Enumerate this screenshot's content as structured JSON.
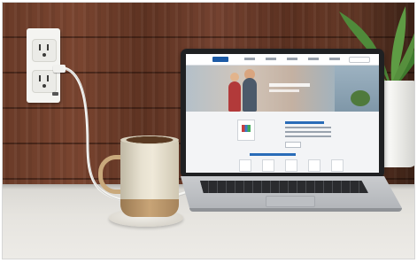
{
  "scene": {
    "subject": "",
    "objects": [
      "wall-outlet-with-usb",
      "charging-cable",
      "coffee-mug",
      "stone-coaster",
      "laptop",
      "potted-plant"
    ]
  },
  "colors": {
    "wood_wall": "#6a3b28",
    "counter": "#e6e4df",
    "outlet_plate": "#f4f4f1",
    "mug_body": "#e7e1d0",
    "mug_base": "#c8a477",
    "laptop_lid": "#1f2022",
    "site_accent": "#2a6cb8",
    "plant_leaf": "#4f8a3a"
  }
}
